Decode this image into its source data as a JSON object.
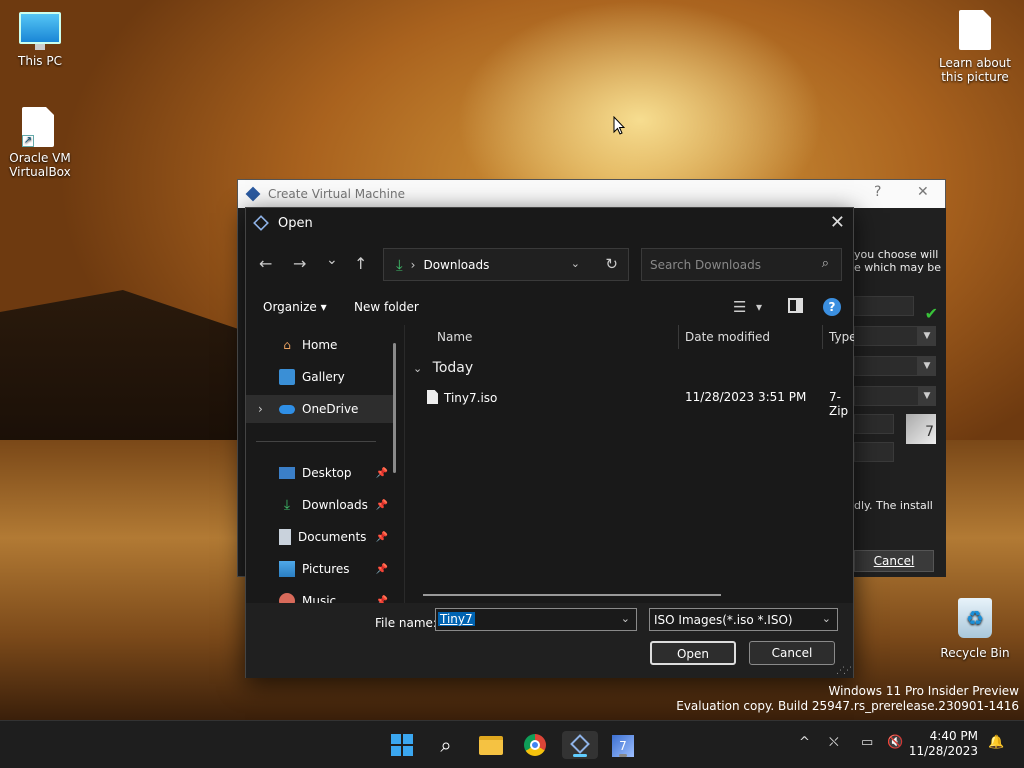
{
  "desktop": {
    "icons": {
      "this_pc": "This PC",
      "virtualbox": "Oracle VM VirtualBox",
      "learn": "Learn about this picture",
      "recycle": "Recycle Bin"
    },
    "watermark": {
      "line1": "Windows 11 Pro Insider Preview",
      "line2": "Evaluation copy. Build 25947.rs_prerelease.230901-1416"
    }
  },
  "vm_window": {
    "title": "Create Virtual Machine",
    "help_glyph": "?",
    "close_glyph": "✕",
    "text_top": "you choose will",
    "text_top2": "e which may be",
    "text_mid": "dly. The install",
    "cancel_label": "Cancel"
  },
  "dialog": {
    "title": "Open",
    "close_glyph": "✕",
    "nav": {
      "back": "←",
      "forward": "→",
      "recent": "⌄",
      "up": "↑"
    },
    "address": {
      "separator": "›",
      "location": "Downloads",
      "chevron": "⌄",
      "refresh": "↻"
    },
    "search": {
      "placeholder": "Search Downloads"
    },
    "toolbar": {
      "organize": "Organize",
      "organize_caret": "▾",
      "new_folder": "New folder",
      "view_caret": "▾",
      "help": "?"
    },
    "navpane": {
      "items": [
        {
          "label": "Home"
        },
        {
          "label": "Gallery"
        },
        {
          "label": "OneDrive"
        },
        {
          "label": "Desktop"
        },
        {
          "label": "Downloads"
        },
        {
          "label": "Documents"
        },
        {
          "label": "Pictures"
        },
        {
          "label": "Music"
        }
      ]
    },
    "columns": {
      "name": "Name",
      "date": "Date modified",
      "type": "Type"
    },
    "group": {
      "label": "Today"
    },
    "files": [
      {
        "name": "Tiny7.iso",
        "date": "11/28/2023 3:51 PM",
        "type": "7-Zip"
      }
    ],
    "bottom": {
      "file_name_label": "File name:",
      "file_name_value": "Tiny7",
      "filter": "ISO Images(*.iso *.ISO)",
      "open_label": "Open",
      "cancel_label": "Cancel"
    }
  },
  "taskbar": {
    "clock": {
      "time": "4:40 PM",
      "date": "11/28/2023"
    },
    "tray_caret": "^"
  },
  "colors": {
    "accent": "#0063b1",
    "downloads_icon": "#3fbf6b",
    "help_badge": "#3b8fe0"
  }
}
